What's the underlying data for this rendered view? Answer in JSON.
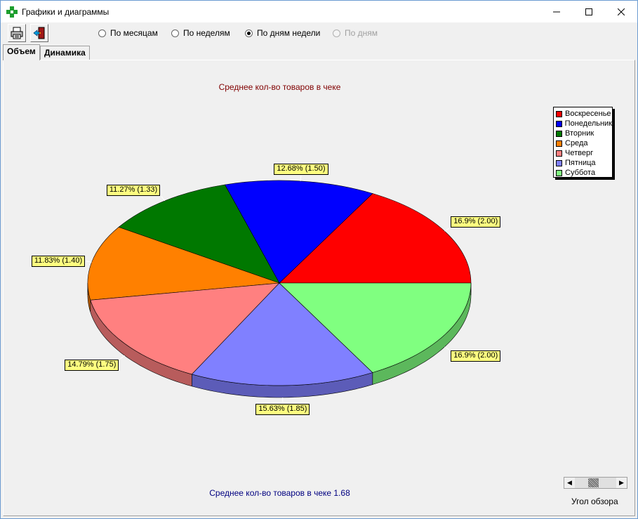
{
  "window": {
    "title": "Графики и диаграммы"
  },
  "toolbar": {
    "print_icon": "printer-icon",
    "exit_icon": "exit-door-icon",
    "periods": [
      {
        "label": "По месяцам",
        "selected": false,
        "enabled": true
      },
      {
        "label": "По неделям",
        "selected": false,
        "enabled": true
      },
      {
        "label": "По дням недели",
        "selected": true,
        "enabled": true
      },
      {
        "label": "По дням",
        "selected": false,
        "enabled": false
      }
    ]
  },
  "tabs": [
    {
      "label": "Объем",
      "active": true
    },
    {
      "label": "Динамика",
      "active": false
    }
  ],
  "chart_data": {
    "type": "pie",
    "title": "Среднее кол-во товаров в чеке",
    "footer": "Среднее кол-во товаров в чеке 1.68",
    "legend_position": "top-right",
    "slices": [
      {
        "name": "Воскресенье",
        "value": 2.0,
        "percent": "16.9%",
        "color": "#ff0000",
        "label": "16.9%  (2.00)"
      },
      {
        "name": "Понедельник",
        "value": 1.5,
        "percent": "12.68%",
        "color": "#0000ff",
        "label": "12.68%  (1.50)"
      },
      {
        "name": "Вторник",
        "value": 1.33,
        "percent": "11.27%",
        "color": "#007800",
        "label": "11.27%  (1.33)"
      },
      {
        "name": "Среда",
        "value": 1.4,
        "percent": "11.83%",
        "color": "#ff8000",
        "label": "11.83%  (1.40)"
      },
      {
        "name": "Четверг",
        "value": 1.75,
        "percent": "14.79%",
        "color": "#ff8080",
        "label": "14.79%  (1.75)"
      },
      {
        "name": "Пятница",
        "value": 1.85,
        "percent": "15.63%",
        "color": "#8080ff",
        "label": "15.63%  (1.85)"
      },
      {
        "name": "Суббота",
        "value": 2.0,
        "percent": "16.9%",
        "color": "#80ff80",
        "label": "16.9%  (2.00)"
      }
    ]
  },
  "view_angle": {
    "label": "Угол обзора"
  }
}
